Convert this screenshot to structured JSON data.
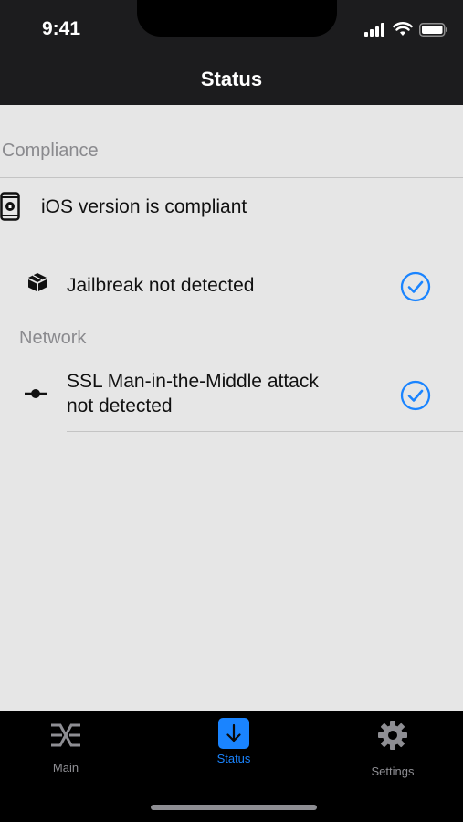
{
  "status_bar": {
    "time": "9:41"
  },
  "nav": {
    "title": "Status"
  },
  "sections": {
    "compliance": {
      "header": "Compliance",
      "ios_row": "iOS version is compliant",
      "jailbreak_row": "Jailbreak not detected"
    },
    "network": {
      "header": "Network",
      "ssl_row_line1": "SSL Man-in-the-Middle attack",
      "ssl_row_line2": "not detected"
    }
  },
  "tabs": {
    "main": "Main",
    "status": "Status",
    "settings": "Settings",
    "active": "status"
  },
  "colors": {
    "accent": "#1a84ff",
    "check": "#1a84ff",
    "header_bg": "#1c1c1e",
    "tabbar_bg": "#000000"
  }
}
